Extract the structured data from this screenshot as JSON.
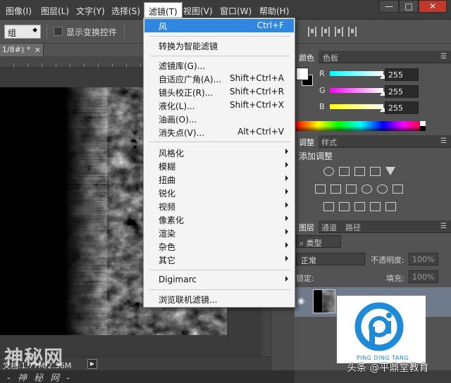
{
  "menubar": {
    "items": [
      "图像(I)",
      "图层(L)",
      "文字(Y)",
      "选择(S)",
      "滤镜(T)",
      "视图(V)",
      "窗口(W)",
      "帮助(H)"
    ],
    "active_index": 4,
    "window_buttons": [
      "—",
      "□",
      "✕"
    ]
  },
  "options": {
    "group_select": "组",
    "show_transform_label": "显示变换控件"
  },
  "document": {
    "tab_label": "1/8#) *",
    "tab_close": "×",
    "status_text": "文档:1.77M/2.36M",
    "status_arrow": "▶"
  },
  "watermark": {
    "big": "神秘网",
    "small": "- 神 秘 网 -"
  },
  "filter_menu": {
    "top_item": {
      "label": "风",
      "shortcut": "Ctrl+F"
    },
    "convert_item": "转换为智能滤镜",
    "special_items": [
      {
        "label": "滤镜库(G)...",
        "shortcut": ""
      },
      {
        "label": "自适应广角(A)...",
        "shortcut": "Shift+Ctrl+A"
      },
      {
        "label": "镜头校正(R)...",
        "shortcut": "Shift+Ctrl+R"
      },
      {
        "label": "液化(L)...",
        "shortcut": "Shift+Ctrl+X"
      },
      {
        "label": "油画(O)...",
        "shortcut": ""
      },
      {
        "label": "消失点(V)...",
        "shortcut": "Alt+Ctrl+V"
      }
    ],
    "submenus": [
      "风格化",
      "模糊",
      "扭曲",
      "锐化",
      "视频",
      "像素化",
      "渲染",
      "杂色",
      "其它"
    ],
    "digimarc": "Digimarc",
    "browse": "浏览联机滤镜..."
  },
  "color_panel": {
    "tabs": [
      "颜色",
      "色板"
    ],
    "channels": [
      {
        "name": "R",
        "value": "255",
        "color": "#ff0000"
      },
      {
        "name": "G",
        "value": "255",
        "color": "#00ff00"
      },
      {
        "name": "B",
        "value": "255",
        "color": "#0000ff"
      }
    ],
    "foreground": "#ffffff",
    "background": "#000000"
  },
  "adjustments_panel": {
    "tabs": [
      "调整",
      "样式"
    ],
    "title": "添加调整"
  },
  "layers_panel": {
    "tabs": [
      "图层",
      "通道",
      "路径"
    ],
    "kind": "类型",
    "blend_mode": "正常",
    "opacity_label": "不透明度:",
    "opacity_value": "100%",
    "lock_label": "锁定:",
    "fill_label": "填充:",
    "fill_value": "100%"
  },
  "logo": {
    "subtitle": "PING DING TANG",
    "credit": "头条 @平鼎堂教育",
    "color": "#1f8bd8"
  }
}
